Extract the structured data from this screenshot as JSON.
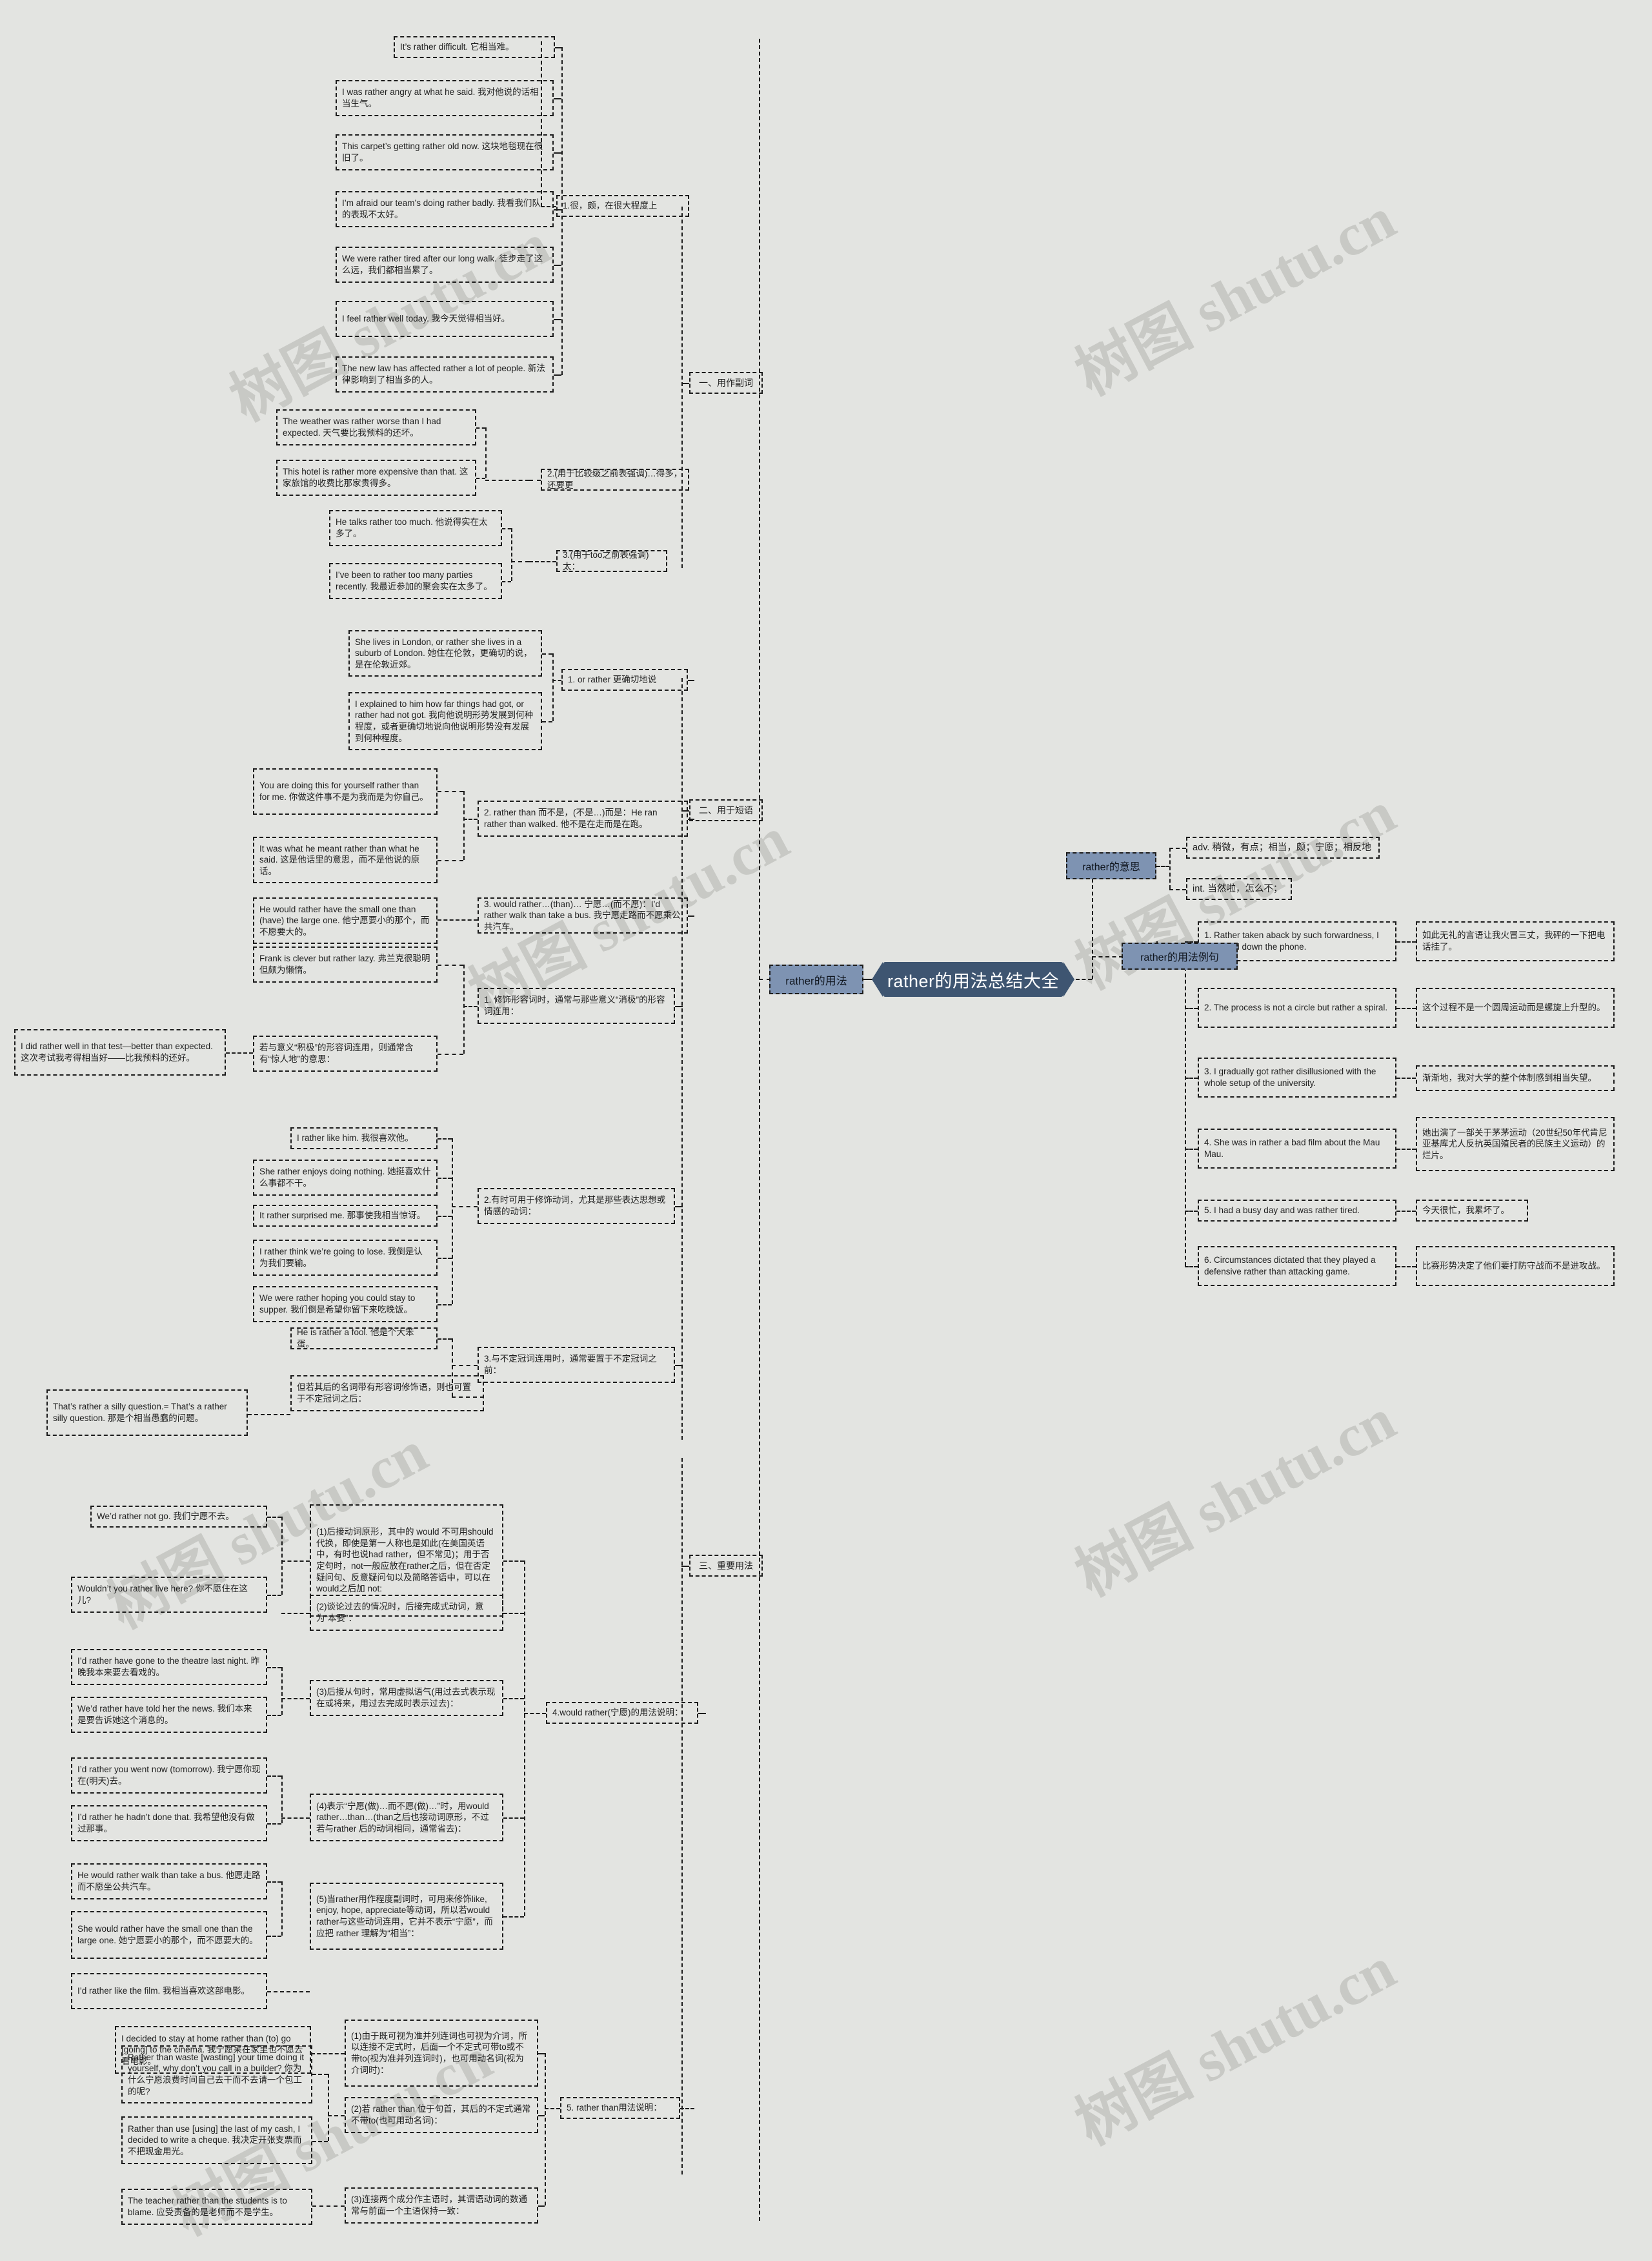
{
  "root": {
    "title": "rather的用法总结大全"
  },
  "branches": {
    "left_label": "rather的用法",
    "meaning_label": "rather的意思",
    "examples_label": "rather的用法例句"
  },
  "meanings": [
    "adv. 稍微，有点；相当，颇；宁愿；相反地",
    "int. 当然啦，怎么不；"
  ],
  "categories": {
    "adverb": "一、用作副词",
    "phrase": "二、用于短语",
    "important": "三、重要用法"
  },
  "adverb_senses": [
    "1.很，颇，在很大程度上",
    "2.(用于比较级之前表强调)…得多，还要更",
    "3.(用于too之前表强调)太："
  ],
  "adverb_examples_1": [
    "It’s rather difficult. 它相当难。",
    "I was rather angry at what he said. 我对他说的话相当生气。",
    "This carpet’s getting rather old now. 这块地毯现在很旧了。",
    "I’m afraid our team’s doing rather badly. 我看我们队的表现不太好。",
    "We were rather tired after our long walk. 徒步走了这么远，我们都相当累了。",
    "I feel rather well today. 我今天觉得相当好。",
    "The new law has affected rather a lot of people. 新法律影响到了相当多的人。"
  ],
  "adverb_examples_2": [
    "The weather was rather worse than I had expected. 天气要比我预料的还坏。",
    "This hotel is rather more expensive than that. 这家旅馆的收费比那家贵得多。"
  ],
  "adverb_examples_3": [
    "He talks rather too much. 他说得实在太多了。",
    "I’ve been to rather too many parties recently. 我最近参加的聚会实在太多了。"
  ],
  "phrase_senses": [
    "1. or rather 更确切地说",
    "2. rather than 而不是，(不是…)而是：He ran rather than walked. 他不是在走而是在跑。",
    "3. would rather…(than)… 宁愿…(而不愿)：I’d rather walk than take a bus. 我宁愿走路而不愿乘公共汽车。"
  ],
  "phrase_examples_1": [
    "She lives in London, or rather she lives in a suburb of London. 她住在伦敦，更确切的说，是在伦敦近郊。",
    "I explained to him how far things had got, or rather had not got. 我向他说明形势发展到何种程度，或者更确切地说向他说明形势没有发展到何种程度。"
  ],
  "phrase_examples_2": [
    "You are doing this for yourself rather than for me. 你做这件事不是为我而是为你自己。",
    "It was what he meant rather than what he said. 这是他话里的意思，而不是他说的原话。"
  ],
  "phrase_examples_3": [
    "He would rather have the small one than (have) the large one. 他宁愿要小的那个，而不愿要大的。"
  ],
  "important_points": [
    "1. 修饰形容词时，通常与那些意义“消极”的形容词连用：",
    "2.有时可用于修饰动词，尤其是那些表达思想或情感的动词：",
    "3.与不定冠词连用时，通常要置于不定冠词之前：",
    "4.would rather(宁愿)的用法说明：",
    "5. rather than用法说明："
  ],
  "negative_adj_examples": [
    "Frank is clever but rather lazy. 弗兰克很聪明但颇为懒惰。"
  ],
  "positive_adj_note": "若与意义“积极”的形容词连用，则通常含有“惊人地”的意思：",
  "positive_adj_example": "I did rather well in that test—better than expected. 这次考试我考得相当好——比我预料的还好。",
  "verb_examples": [
    "I rather like him. 我很喜欢他。",
    "She rather enjoys doing nothing. 她挺喜欢什么事都不干。",
    "It rather surprised me. 那事使我相当惊讶。",
    "I rather think we’re going to lose. 我倒是认为我们要输。",
    "We were rather hoping you could stay to supper. 我们倒是希望你留下来吃晚饭。"
  ],
  "article_examples": [
    "He is rather a fool. 他是个大笨蛋。"
  ],
  "article_note": "但若其后的名词带有形容词修饰语，则也可置于不定冠词之后：",
  "article_note_example": "That’s rather a silly question.= That’s a rather silly question. 那是个相当愚蠢的问题。",
  "would_rather_notes": [
    "(1)后接动词原形，其中的 would 不可用should代换，即使是第一人称也是如此(在美国英语中，有时也说had rather，但不常见)；用于否定句时，not一般应放在rather之后，但在否定疑问句、反意疑问句以及简略答语中，可以在would之后加 not:",
    "(2)谈论过去的情况时，后接完成式动词，意为“本要”：",
    "(3)后接从句时，常用虚拟语气(用过去式表示现在或将来，用过去完成时表示过去)：",
    "(4)表示“宁愿(做)…而不愿(做)…”时，用would rather…than…(than之后也接动词原形，不过若与rather 后的动词相同，通常省去)：",
    "(5)当rather用作程度副词时，可用来修饰like, enjoy, hope, appreciate等动词，所以若would rather与这些动词连用，它并不表示“宁愿”，而应把 rather 理解为“相当”："
  ],
  "would_rather_examples_1": [
    "We’d rather not go. 我们宁愿不去。",
    "Wouldn’t you rather live here? 你不愿住在这儿?"
  ],
  "would_rather_examples_2": [
    "I’d rather have gone to the theatre last night. 昨晚我本来要去看戏的。",
    "We’d rather have told her the news. 我们本来是要告诉她这个消息的。"
  ],
  "would_rather_examples_3": [
    "I’d rather you went now (tomorrow). 我宁愿你现在(明天)去。",
    "I’d rather he hadn’t done that. 我希望他没有做过那事。"
  ],
  "would_rather_examples_4": [
    "He would rather walk than take a bus. 他愿走路而不愿坐公共汽车。",
    "She would rather have the small one than the large one. 她宁愿要小的那个，而不愿要大的。"
  ],
  "would_rather_examples_5": [
    "I’d rather like the film. 我相当喜欢这部电影。"
  ],
  "rather_than_notes": [
    "(1)由于既可视为准并列连词也可视为介词，所以连接不定式时，后面一个不定式可带to或不带to(视为准并列连词时)，也可用动名词(视为介词时)：",
    "(2)若 rather than 位于句首，其后的不定式通常不带to(也可用动名词)：",
    "(3)连接两个成分作主语时，其谓语动词的数通常与前面一个主语保持一致："
  ],
  "rather_than_examples_1": [
    "I decided to stay at home rather than (to) go [going] to the cinema. 我宁愿呆在家里也不愿去看电影。"
  ],
  "rather_than_examples_2": [
    "Rather than waste [wasting] your time doing it yourself, why don’t you call in a builder? 你为什么宁愿浪费时间自己去干而不去请一个包工的呢?",
    "Rather than use [using] the last of my cash, I decided to write a cheque. 我决定开张支票而不把现金用光。"
  ],
  "rather_than_examples_3": [
    "The teacher rather than the students is to blame. 应受责备的是老师而不是学生。"
  ],
  "sentence_examples": [
    {
      "en": "1. Rather taken aback by such forwardness, I slammed down the phone.",
      "zh": "如此无礼的言语让我火冒三丈，我砰的一下把电话挂了。"
    },
    {
      "en": "2. The process is not a circle but rather a spiral.",
      "zh": "这个过程不是一个圆周运动而是螺旋上升型的。"
    },
    {
      "en": "3. I gradually got rather disillusioned with the whole setup of the university.",
      "zh": "渐渐地，我对大学的整个体制感到相当失望。"
    },
    {
      "en": "4. She was in rather a bad film about the Mau Mau.",
      "zh": "她出演了一部关于茅茅运动（20世纪50年代肯尼亚基库尤人反抗英国殖民者的民族主义运动）的烂片。"
    },
    {
      "en": "5. I had a busy day and was rather tired.",
      "zh": "今天很忙，我累坏了。"
    },
    {
      "en": "6. Circumstances dictated that they played a defensive rather than attacking game.",
      "zh": "比赛形势决定了他们要打防守战而不是进攻战。"
    }
  ],
  "watermarks": [
    "树图 shutu.cn",
    "树图 shutu.cn",
    "树图 shutu.cn",
    "树图 shutu.cn",
    "树图 shutu.cn",
    "树图 shutu.cn",
    "树图 shutu.cn",
    "树图 shutu.cn"
  ],
  "colors": {
    "background": "#e3e4e1",
    "root_fill": "#3e5571",
    "level1_fill": "#7e93b2",
    "border": "#1b1b1b",
    "text": "#1f1f1f",
    "watermark": "#c8c9c5"
  }
}
